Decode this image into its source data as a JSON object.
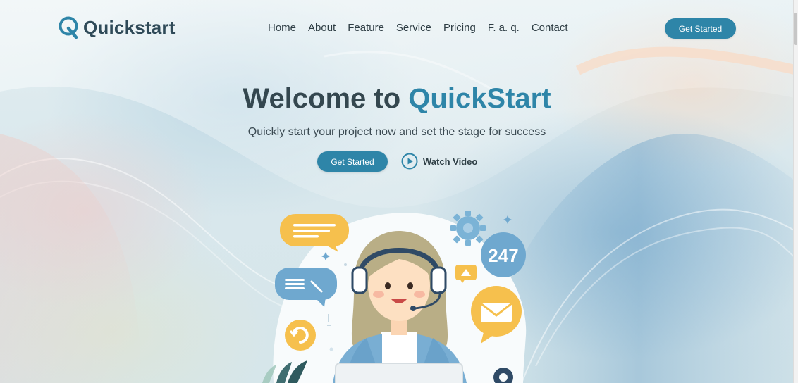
{
  "brand": {
    "name": "Quickstart",
    "logo_letter": "Q"
  },
  "nav": {
    "items": [
      {
        "label": "Home"
      },
      {
        "label": "About"
      },
      {
        "label": "Feature"
      },
      {
        "label": "Service"
      },
      {
        "label": "Pricing"
      },
      {
        "label": "F. a. q."
      },
      {
        "label": "Contact"
      }
    ],
    "cta_label": "Get Started"
  },
  "hero": {
    "title_prefix": "Welcome to ",
    "title_accent": "QuickStart",
    "subtitle": "Quickly start your project now and set the stage for success",
    "primary_button": "Get Started",
    "video_link": "Watch Video"
  },
  "illustration": {
    "badge_text": "247"
  },
  "colors": {
    "accent": "#2e85a8",
    "title": "#34474f",
    "bubble_yellow": "#f6c04d",
    "bubble_blue": "#6fa8cf"
  }
}
